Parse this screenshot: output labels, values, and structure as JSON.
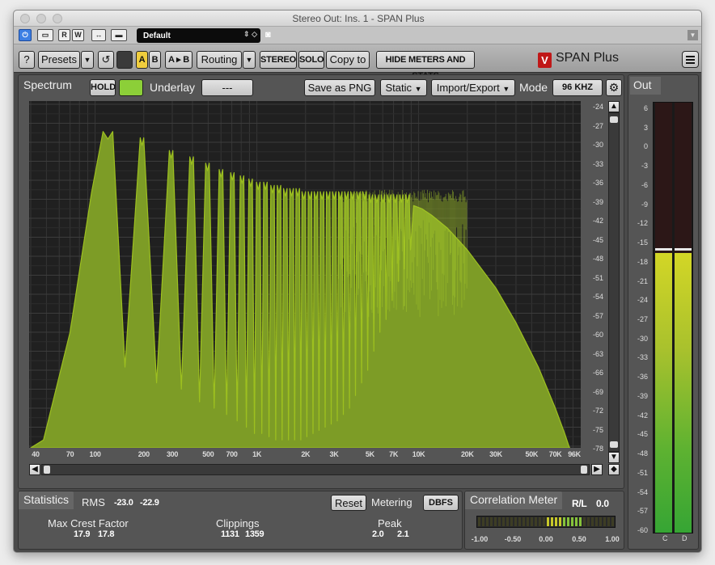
{
  "window": {
    "title": "Stereo Out: Ins. 1 - SPAN Plus"
  },
  "host_bar": {
    "power_icon": "power-icon",
    "compare_label": "↔",
    "read_label": "R",
    "write_label": "W",
    "preset_name": "Default",
    "camera_icon": "camera-icon"
  },
  "toolbar": {
    "help": "?",
    "presets": "Presets",
    "a": "A",
    "b": "B",
    "a_to_b": "A ▸ B",
    "routing": "Routing",
    "stereo": "STEREO",
    "solo": "SOLO",
    "copy_to": "Copy to",
    "hide_meters": "HIDE METERS AND STATS",
    "product": "SPAN Plus",
    "logo_letter": "V"
  },
  "spectrum": {
    "tab": "Spectrum",
    "hold": "HOLD",
    "underlay_label": "Underlay",
    "underlay_value": "---",
    "save_png": "Save as PNG",
    "static": "Static",
    "import_export": "Import/Export",
    "mode_label": "Mode",
    "mode_value": "96 KHZ",
    "accent_color": "#9dc01f",
    "fill_color": "#7d9c26",
    "y_ticks": [
      "-24",
      "-27",
      "-30",
      "-33",
      "-36",
      "-39",
      "-42",
      "-45",
      "-48",
      "-51",
      "-54",
      "-57",
      "-60",
      "-63",
      "-66",
      "-69",
      "-72",
      "-75",
      "-78"
    ],
    "x_ticks": [
      "40",
      "70",
      "100",
      "200",
      "300",
      "500",
      "700",
      "1K",
      "2K",
      "3K",
      "5K",
      "7K",
      "10K",
      "20K",
      "30K",
      "50K",
      "70K",
      "96K"
    ]
  },
  "output": {
    "tab": "Out",
    "scale": [
      "6",
      "3",
      "0",
      "-3",
      "-6",
      "-9",
      "-12",
      "-15",
      "-18",
      "-21",
      "-24",
      "-27",
      "-30",
      "-33",
      "-36",
      "-39",
      "-42",
      "-45",
      "-48",
      "-51",
      "-54",
      "-57",
      "-60"
    ],
    "channel_left": "C",
    "channel_right": "D",
    "level_left_db": -17,
    "level_right_db": -17,
    "peak_db": -16.5
  },
  "statistics": {
    "tab": "Statistics",
    "rms_label": "RMS",
    "rms_left": "-23.0",
    "rms_right": "-22.9",
    "reset": "Reset",
    "metering_label": "Metering",
    "metering_value": "DBFS",
    "max_crest_label": "Max Crest Factor",
    "max_crest_left": "17.9",
    "max_crest_right": "17.8",
    "clippings_label": "Clippings",
    "clippings_left": "1131",
    "clippings_right": "1359",
    "peak_label": "Peak",
    "peak_left": "2.0",
    "peak_right": "2.1"
  },
  "correlation": {
    "tab": "Correlation Meter",
    "mode": "R/L",
    "value": "0.0",
    "scale": [
      "-1.00",
      "-0.50",
      "0.00",
      "0.50",
      "1.00"
    ]
  }
}
